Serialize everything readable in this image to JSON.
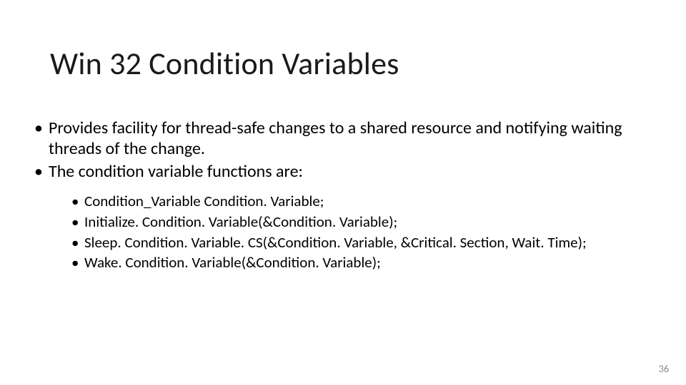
{
  "title": "Win 32 Condition Variables",
  "bullets": {
    "b1": "Provides facility for thread-safe changes to a shared resource and notifying waiting threads of the change.",
    "b2": "The condition variable functions are:",
    "sub": {
      "s1": "Condition_Variable Condition. Variable;",
      "s2": "Initialize. Condition. Variable(&Condition. Variable);",
      "s3": "Sleep. Condition. Variable. CS(&Condition. Variable, &Critical. Section, Wait. Time);",
      "s4": "Wake. Condition. Variable(&Condition. Variable);"
    }
  },
  "page_number": "36"
}
